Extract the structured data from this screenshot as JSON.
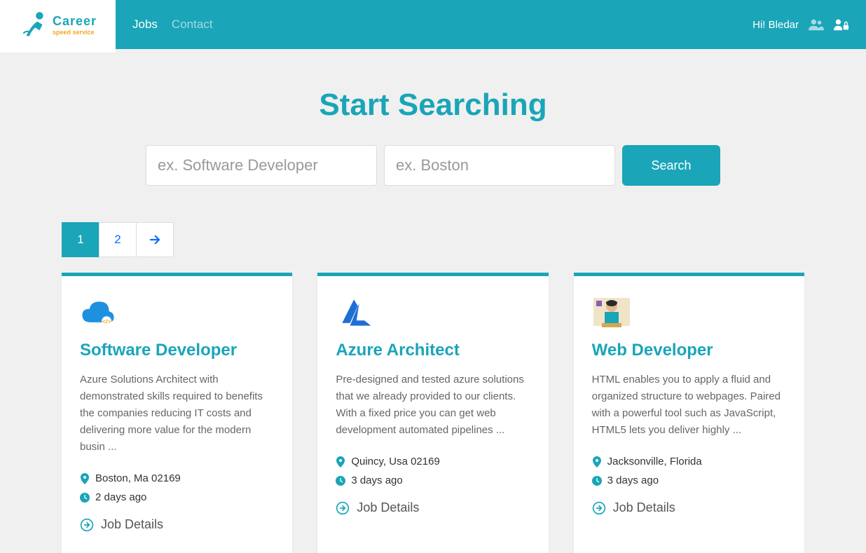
{
  "brand": {
    "name": "Career",
    "sub": "speed service"
  },
  "nav": {
    "links": [
      {
        "label": "Jobs",
        "active": true
      },
      {
        "label": "Contact",
        "active": false
      }
    ],
    "greeting": "Hi! Bledar"
  },
  "search": {
    "title": "Start Searching",
    "keyword_placeholder": "ex. Software Developer",
    "location_placeholder": "ex. Boston",
    "button": "Search"
  },
  "pagination": {
    "pages": [
      "1",
      "2"
    ],
    "active": 0
  },
  "jobs": [
    {
      "title": "Software Developer",
      "description": "Azure Solutions Architect with demonstrated skills required to benefits the companies reducing IT costs and delivering more value for the modern busin ...",
      "location": "Boston, Ma 02169",
      "posted": "2 days ago",
      "details_label": "Job Details"
    },
    {
      "title": "Azure Architect",
      "description": "Pre-designed and tested azure solutions that we already provided to our clients. With a fixed price you can get web development automated pipelines ...",
      "location": "Quincy, Usa 02169",
      "posted": "3 days ago",
      "details_label": "Job Details"
    },
    {
      "title": "Web Developer",
      "description": "HTML enables you to apply a fluid and organized structure to webpages. Paired with a powerful tool such as JavaScript, HTML5 lets you deliver highly ...",
      "location": "Jacksonville, Florida",
      "posted": "3 days ago",
      "details_label": "Job Details"
    }
  ]
}
